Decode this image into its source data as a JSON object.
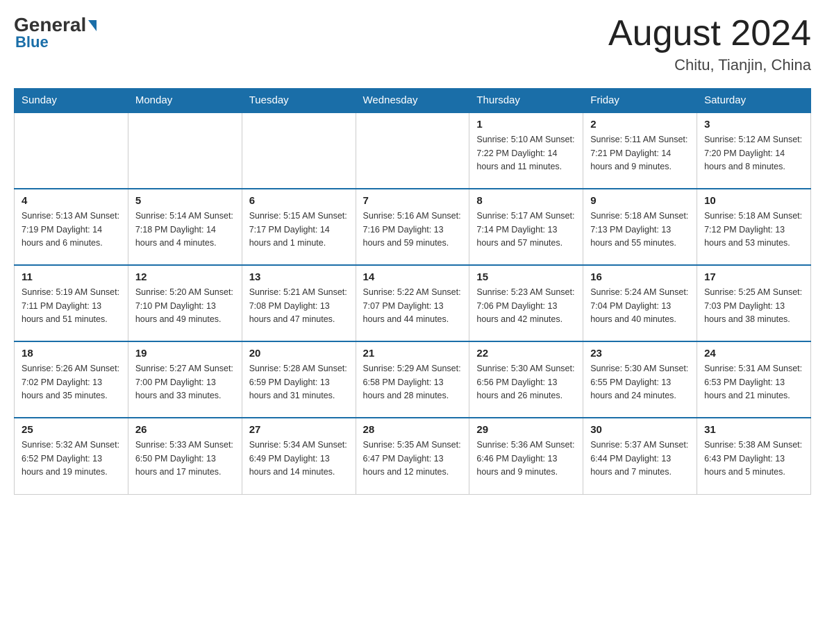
{
  "header": {
    "logo_general": "General",
    "logo_blue": "Blue",
    "month_title": "August 2024",
    "location": "Chitu, Tianjin, China"
  },
  "days_of_week": [
    "Sunday",
    "Monday",
    "Tuesday",
    "Wednesday",
    "Thursday",
    "Friday",
    "Saturday"
  ],
  "weeks": [
    [
      {
        "day": "",
        "info": ""
      },
      {
        "day": "",
        "info": ""
      },
      {
        "day": "",
        "info": ""
      },
      {
        "day": "",
        "info": ""
      },
      {
        "day": "1",
        "info": "Sunrise: 5:10 AM\nSunset: 7:22 PM\nDaylight: 14 hours and 11 minutes."
      },
      {
        "day": "2",
        "info": "Sunrise: 5:11 AM\nSunset: 7:21 PM\nDaylight: 14 hours and 9 minutes."
      },
      {
        "day": "3",
        "info": "Sunrise: 5:12 AM\nSunset: 7:20 PM\nDaylight: 14 hours and 8 minutes."
      }
    ],
    [
      {
        "day": "4",
        "info": "Sunrise: 5:13 AM\nSunset: 7:19 PM\nDaylight: 14 hours and 6 minutes."
      },
      {
        "day": "5",
        "info": "Sunrise: 5:14 AM\nSunset: 7:18 PM\nDaylight: 14 hours and 4 minutes."
      },
      {
        "day": "6",
        "info": "Sunrise: 5:15 AM\nSunset: 7:17 PM\nDaylight: 14 hours and 1 minute."
      },
      {
        "day": "7",
        "info": "Sunrise: 5:16 AM\nSunset: 7:16 PM\nDaylight: 13 hours and 59 minutes."
      },
      {
        "day": "8",
        "info": "Sunrise: 5:17 AM\nSunset: 7:14 PM\nDaylight: 13 hours and 57 minutes."
      },
      {
        "day": "9",
        "info": "Sunrise: 5:18 AM\nSunset: 7:13 PM\nDaylight: 13 hours and 55 minutes."
      },
      {
        "day": "10",
        "info": "Sunrise: 5:18 AM\nSunset: 7:12 PM\nDaylight: 13 hours and 53 minutes."
      }
    ],
    [
      {
        "day": "11",
        "info": "Sunrise: 5:19 AM\nSunset: 7:11 PM\nDaylight: 13 hours and 51 minutes."
      },
      {
        "day": "12",
        "info": "Sunrise: 5:20 AM\nSunset: 7:10 PM\nDaylight: 13 hours and 49 minutes."
      },
      {
        "day": "13",
        "info": "Sunrise: 5:21 AM\nSunset: 7:08 PM\nDaylight: 13 hours and 47 minutes."
      },
      {
        "day": "14",
        "info": "Sunrise: 5:22 AM\nSunset: 7:07 PM\nDaylight: 13 hours and 44 minutes."
      },
      {
        "day": "15",
        "info": "Sunrise: 5:23 AM\nSunset: 7:06 PM\nDaylight: 13 hours and 42 minutes."
      },
      {
        "day": "16",
        "info": "Sunrise: 5:24 AM\nSunset: 7:04 PM\nDaylight: 13 hours and 40 minutes."
      },
      {
        "day": "17",
        "info": "Sunrise: 5:25 AM\nSunset: 7:03 PM\nDaylight: 13 hours and 38 minutes."
      }
    ],
    [
      {
        "day": "18",
        "info": "Sunrise: 5:26 AM\nSunset: 7:02 PM\nDaylight: 13 hours and 35 minutes."
      },
      {
        "day": "19",
        "info": "Sunrise: 5:27 AM\nSunset: 7:00 PM\nDaylight: 13 hours and 33 minutes."
      },
      {
        "day": "20",
        "info": "Sunrise: 5:28 AM\nSunset: 6:59 PM\nDaylight: 13 hours and 31 minutes."
      },
      {
        "day": "21",
        "info": "Sunrise: 5:29 AM\nSunset: 6:58 PM\nDaylight: 13 hours and 28 minutes."
      },
      {
        "day": "22",
        "info": "Sunrise: 5:30 AM\nSunset: 6:56 PM\nDaylight: 13 hours and 26 minutes."
      },
      {
        "day": "23",
        "info": "Sunrise: 5:30 AM\nSunset: 6:55 PM\nDaylight: 13 hours and 24 minutes."
      },
      {
        "day": "24",
        "info": "Sunrise: 5:31 AM\nSunset: 6:53 PM\nDaylight: 13 hours and 21 minutes."
      }
    ],
    [
      {
        "day": "25",
        "info": "Sunrise: 5:32 AM\nSunset: 6:52 PM\nDaylight: 13 hours and 19 minutes."
      },
      {
        "day": "26",
        "info": "Sunrise: 5:33 AM\nSunset: 6:50 PM\nDaylight: 13 hours and 17 minutes."
      },
      {
        "day": "27",
        "info": "Sunrise: 5:34 AM\nSunset: 6:49 PM\nDaylight: 13 hours and 14 minutes."
      },
      {
        "day": "28",
        "info": "Sunrise: 5:35 AM\nSunset: 6:47 PM\nDaylight: 13 hours and 12 minutes."
      },
      {
        "day": "29",
        "info": "Sunrise: 5:36 AM\nSunset: 6:46 PM\nDaylight: 13 hours and 9 minutes."
      },
      {
        "day": "30",
        "info": "Sunrise: 5:37 AM\nSunset: 6:44 PM\nDaylight: 13 hours and 7 minutes."
      },
      {
        "day": "31",
        "info": "Sunrise: 5:38 AM\nSunset: 6:43 PM\nDaylight: 13 hours and 5 minutes."
      }
    ]
  ]
}
